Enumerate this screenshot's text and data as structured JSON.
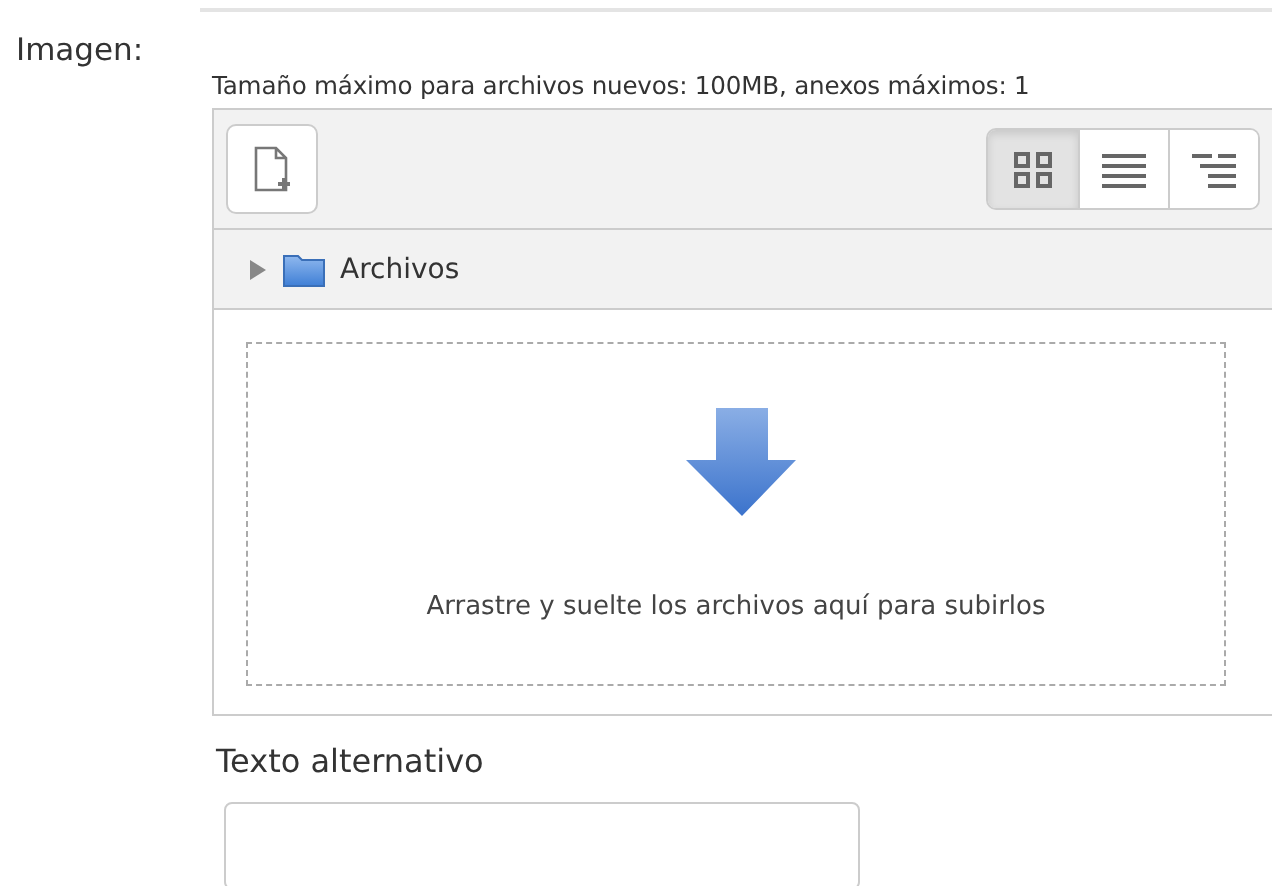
{
  "field_label": "Imagen:",
  "file_picker": {
    "limits": "Tamaño máximo para archivos nuevos: 100MB, anexos máximos: 1",
    "views": [
      {
        "kind": "icons",
        "selected": true
      },
      {
        "kind": "list",
        "selected": false
      },
      {
        "kind": "tree",
        "selected": false
      }
    ],
    "folder": {
      "name": "Archivos",
      "expanded": false
    },
    "dropzone_text": "Arrastre y suelte los archivos aquí para subirlos"
  },
  "alt_text": {
    "label": "Texto alternativo"
  }
}
